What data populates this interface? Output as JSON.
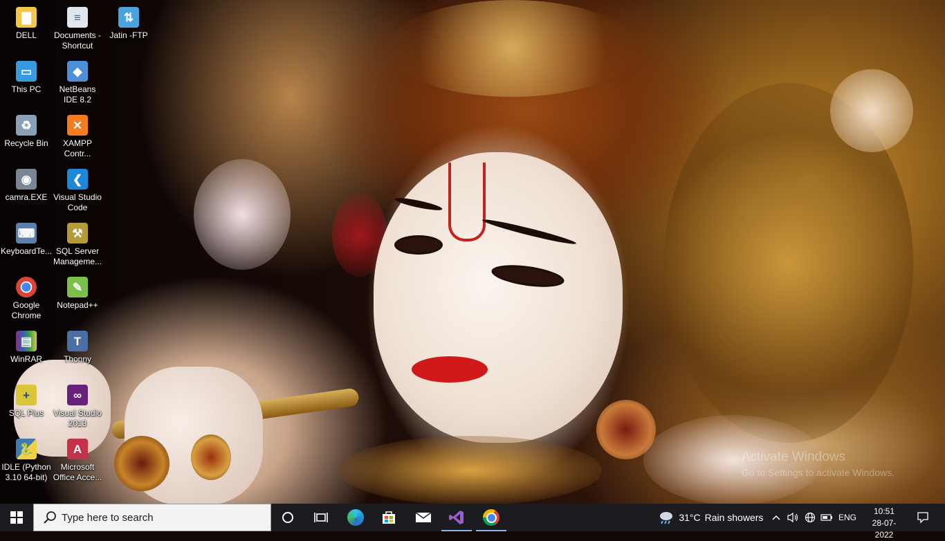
{
  "desktop": {
    "icons": [
      {
        "label": "DELL",
        "icon": "folder-user-icon",
        "color": "#f3c64a"
      },
      {
        "label": "This PC",
        "icon": "monitor-icon",
        "color": "#3a9ae0"
      },
      {
        "label": "Recycle Bin",
        "icon": "recycle-bin-icon",
        "color": "#8aa0b4"
      },
      {
        "label": "camra.EXE",
        "icon": "camera-app-icon",
        "color": "#7a8694"
      },
      {
        "label": "KeyboardTe...",
        "icon": "keyboard-test-icon",
        "color": "#5b7faa"
      },
      {
        "label": "Google Chrome",
        "icon": "chrome-icon",
        "color": "#db4437"
      },
      {
        "label": "WinRAR",
        "icon": "winrar-icon",
        "color": "#8b2f7c"
      },
      {
        "label": "SQL Plus",
        "icon": "sql-plus-icon",
        "color": "#d9c43a"
      },
      {
        "label": "IDLE (Python 3.10 64-bit)",
        "icon": "python-idle-icon",
        "color": "#3f7ab5"
      },
      {
        "label": "Documents - Shortcut",
        "icon": "document-shortcut-icon",
        "color": "#dfe6ee"
      },
      {
        "label": "NetBeans IDE 8.2",
        "icon": "netbeans-icon",
        "color": "#4d8fd9"
      },
      {
        "label": "XAMPP Contr...",
        "icon": "xampp-icon",
        "color": "#f37b20"
      },
      {
        "label": "Visual Studio Code",
        "icon": "vscode-icon",
        "color": "#1e88d8"
      },
      {
        "label": "SQL Server Manageme...",
        "icon": "sql-server-icon",
        "color": "#b59a3a"
      },
      {
        "label": "Notepad++",
        "icon": "notepad-plus-plus-icon",
        "color": "#7cbf4a"
      },
      {
        "label": "Thonny",
        "icon": "thonny-icon",
        "color": "#4a6fa5"
      },
      {
        "label": "Visual Studio 2013",
        "icon": "visual-studio-icon",
        "color": "#68217a"
      },
      {
        "label": "Microsoft Office Acce...",
        "icon": "ms-access-icon",
        "color": "#c4314b"
      },
      {
        "label": "Jatin -FTP",
        "icon": "ftp-folder-icon",
        "color": "#4aa3df"
      }
    ],
    "watermark": {
      "line1": "Activate Windows",
      "line2": "Go to Settings to activate Windows."
    }
  },
  "taskbar": {
    "search_placeholder": "Type here to search",
    "apps": [
      {
        "name": "cortana",
        "icon": "cortana-circle-icon",
        "active": false
      },
      {
        "name": "task-view",
        "icon": "task-view-icon",
        "active": false
      },
      {
        "name": "edge",
        "icon": "edge-icon",
        "active": false
      },
      {
        "name": "store",
        "icon": "store-icon",
        "active": false
      },
      {
        "name": "mail",
        "icon": "mail-icon",
        "active": false
      },
      {
        "name": "visual-studio",
        "icon": "visual-studio-icon",
        "active": true
      },
      {
        "name": "chrome",
        "icon": "chrome-icon",
        "active": true
      }
    ],
    "weather": {
      "temp": "31°C",
      "condition": "Rain showers"
    },
    "language": "ENG",
    "time": "10:51",
    "date": "28-07-2022"
  }
}
